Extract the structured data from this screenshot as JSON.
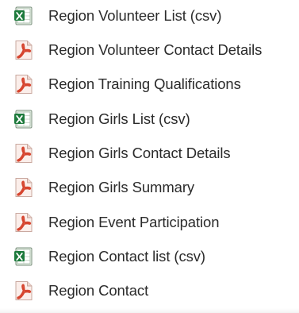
{
  "reports": [
    {
      "label": "Region Volunteer List (csv)",
      "icon": "excel-icon"
    },
    {
      "label": "Region Volunteer Contact Details",
      "icon": "pdf-icon"
    },
    {
      "label": "Region Training Qualifications",
      "icon": "pdf-icon"
    },
    {
      "label": "Region Girls List (csv)",
      "icon": "excel-icon"
    },
    {
      "label": "Region Girls Contact Details",
      "icon": "pdf-icon"
    },
    {
      "label": "Region Girls Summary",
      "icon": "pdf-icon"
    },
    {
      "label": "Region Event Participation",
      "icon": "pdf-icon"
    },
    {
      "label": "Region Contact list (csv)",
      "icon": "excel-icon"
    },
    {
      "label": "Region Contact",
      "icon": "pdf-icon"
    }
  ],
  "colors": {
    "text": "#2b2b2b",
    "excel_green": "#1d7a3c",
    "pdf_red": "#d6452f"
  }
}
